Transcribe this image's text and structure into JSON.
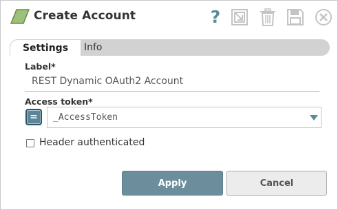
{
  "header": {
    "title": "Create Account",
    "help_glyph": "?",
    "icons": [
      "app-logo-icon",
      "help-icon",
      "export-icon",
      "delete-icon",
      "save-icon",
      "close-icon"
    ]
  },
  "tabs": [
    {
      "label": "Settings",
      "selected": true
    },
    {
      "label": "Info",
      "selected": false
    }
  ],
  "form": {
    "label_field": {
      "label": "Label*",
      "value": "REST Dynamic OAuth2 Account"
    },
    "access_token": {
      "label": "Access token*",
      "value": "_AccessToken",
      "expression_glyph": "="
    },
    "header_authenticated": {
      "label": "Header authenticated",
      "checked": false
    }
  },
  "buttons": {
    "apply": "Apply",
    "cancel": "Cancel"
  },
  "colors": {
    "accent": "#6c8d9c",
    "icon_gray": "#c4c4c4",
    "logo_fill": "#9dc07a",
    "tab_bar": "#d2d2d2"
  }
}
